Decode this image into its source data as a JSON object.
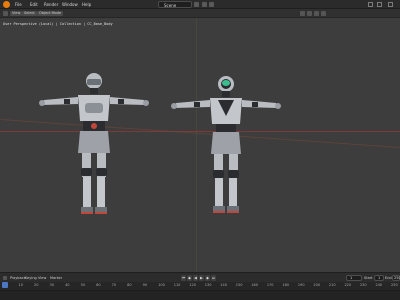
{
  "topbar": {
    "menus": [
      "File",
      "Edit",
      "Render",
      "Window",
      "Help"
    ],
    "scene": "Scene"
  },
  "viewport_header": {
    "mode": "Object Mode",
    "view": "View",
    "select": "Select",
    "add": "Add",
    "object": "Object"
  },
  "viewport": {
    "info_line": "User Perspective (Local)  |  Collection | CC_Base_Body"
  },
  "timeline": {
    "menus": [
      "Playback",
      "Keying",
      "View",
      "Marker"
    ],
    "current_frame": "1",
    "start_label": "Start",
    "start": "1",
    "end_label": "End",
    "end": "250",
    "ticks": [
      "0",
      "10",
      "20",
      "30",
      "40",
      "50",
      "60",
      "70",
      "80",
      "90",
      "100",
      "110",
      "120",
      "130",
      "140",
      "150",
      "160",
      "170",
      "180",
      "190",
      "200",
      "210",
      "220",
      "230",
      "240",
      "250"
    ]
  },
  "colors": {
    "accent": "#e87d0d",
    "panel": "#2b2b2b",
    "viewport": "#3d3d3d",
    "horizon": "#8a3a3a",
    "robot_body": "#b9bdc2",
    "robot_dark": "#2a2c30",
    "visor_green": "#3bbf8e",
    "playhead": "#4b78c4"
  }
}
